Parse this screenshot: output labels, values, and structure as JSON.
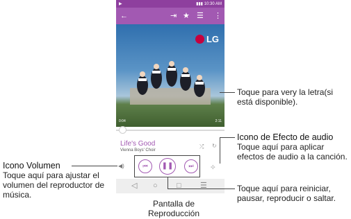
{
  "status_bar": {
    "time": "10:30 AM"
  },
  "app_bar": {
    "icons": [
      "back-arrow-icon",
      "share-icon",
      "star-icon",
      "list-icon",
      "more-vert-icon"
    ]
  },
  "album_art": {
    "logo_text": "LG"
  },
  "player": {
    "elapsed": "0:04",
    "remaining": "2:11",
    "progress_fraction": 0.03,
    "song_title": "Life's Good",
    "artist": "Vienna Boys' Choir"
  },
  "callouts": {
    "lyrics": "Toque para very la letra(si está disponible).",
    "audio_effect_title": "Icono de Efecto de audio",
    "audio_effect_desc": "Toque aquí para aplicar efectos de audio a la canción.",
    "volume_title": "Icono Volumen",
    "volume_desc": "Toque aquí para ajustar el volumen del reproductor de música.",
    "controls_desc": "Toque aquí para reiniciar, pausar, reproducir o saltar."
  },
  "caption": "Pantalla de Reproducción",
  "colors": {
    "accent": "#a259b2",
    "status_bar": "#8e3f9e",
    "nav_bar": "#eeeeee",
    "lg_red": "#c5003e"
  }
}
